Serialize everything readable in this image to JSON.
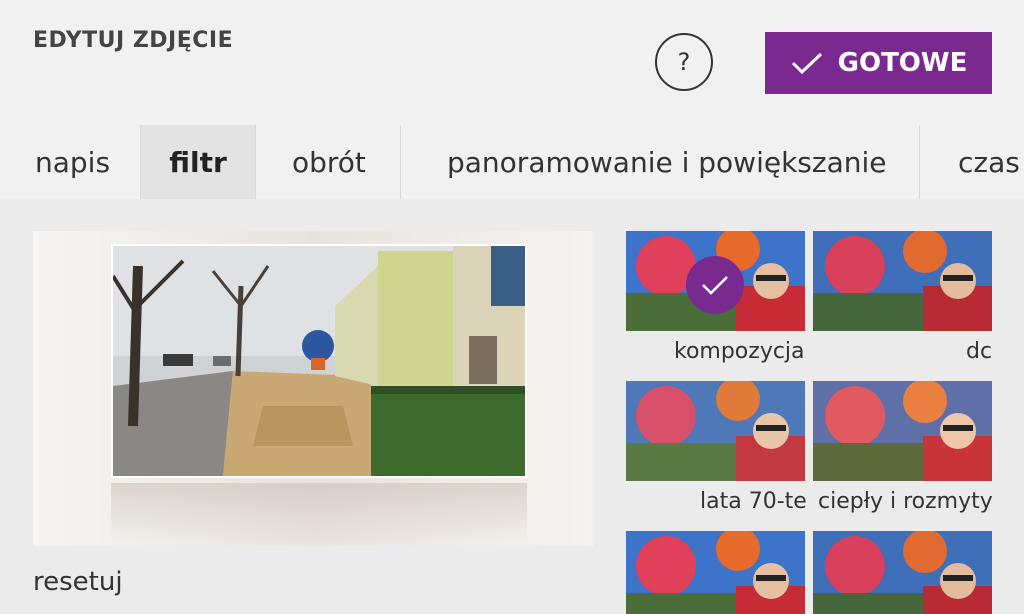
{
  "header": {
    "title": "EDYTUJ ZDJĘCIE",
    "help_label": "?",
    "done_label": "GOTOWE"
  },
  "tabs": [
    {
      "label": "napis"
    },
    {
      "label": "filtr"
    },
    {
      "label": "obrót"
    },
    {
      "label": "panoramowanie i powiększanie"
    },
    {
      "label": "czas"
    }
  ],
  "active_tab": "filtr",
  "preview": {
    "reset_label": "resetuj"
  },
  "filters": [
    {
      "label": "kompozycja",
      "selected": true
    },
    {
      "label": "dc",
      "selected": false
    },
    {
      "label": "lata 70-te",
      "selected": false
    },
    {
      "label": "ciepły i rozmyty",
      "selected": false
    },
    {
      "label": "",
      "selected": false
    },
    {
      "label": "",
      "selected": false
    }
  ],
  "colors": {
    "accent": "#7a2a8f",
    "background": "#ebebeb",
    "header": "#f1f1f1"
  },
  "icons": [
    "help-icon",
    "checkmark-icon",
    "selected-check-icon"
  ]
}
